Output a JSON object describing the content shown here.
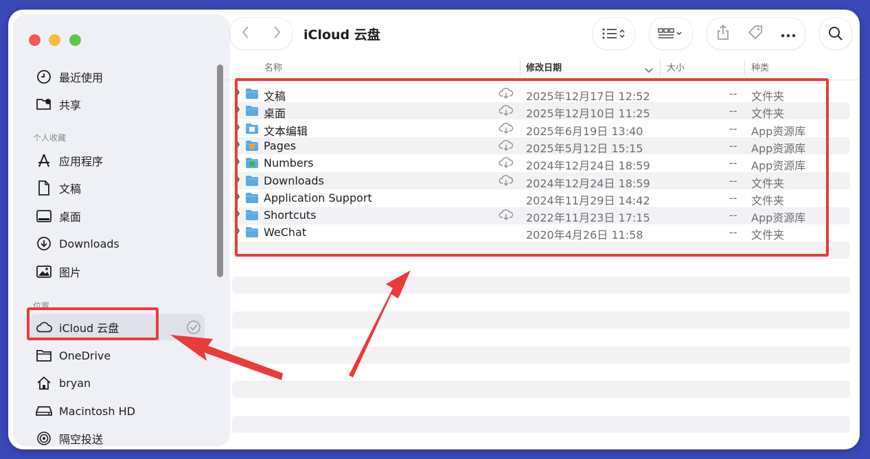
{
  "window": {
    "title": "iCloud 云盘"
  },
  "sidebar": {
    "top_items": [
      {
        "label": "最近使用",
        "icon": "clock-icon"
      },
      {
        "label": "共享",
        "icon": "shared-folder-icon"
      }
    ],
    "favorites_title": "个人收藏",
    "favorites": [
      {
        "label": "应用程序",
        "icon": "apps-icon"
      },
      {
        "label": "文稿",
        "icon": "document-icon"
      },
      {
        "label": "桌面",
        "icon": "desktop-icon"
      },
      {
        "label": "Downloads",
        "icon": "download-icon"
      },
      {
        "label": "图片",
        "icon": "photo-icon"
      }
    ],
    "locations_title": "位置",
    "locations": [
      {
        "label": "iCloud 云盘",
        "icon": "cloud-icon",
        "selected": true
      },
      {
        "label": "OneDrive",
        "icon": "folder-icon"
      },
      {
        "label": "bryan",
        "icon": "home-icon"
      },
      {
        "label": "Macintosh HD",
        "icon": "disk-icon"
      },
      {
        "label": "隔空投送",
        "icon": "airdrop-icon"
      }
    ]
  },
  "columns": {
    "name": "名称",
    "modified": "修改日期",
    "size": "大小",
    "kind": "种类"
  },
  "files": [
    {
      "name": "文稿",
      "cloud": true,
      "date": "2025年12月17日 12:52",
      "size": "--",
      "kind": "文件夹",
      "icon": "folder"
    },
    {
      "name": "桌面",
      "cloud": true,
      "date": "2025年12月10日 11:25",
      "size": "--",
      "kind": "文件夹",
      "icon": "folder"
    },
    {
      "name": "文本编辑",
      "cloud": true,
      "date": "2025年6月19日 13:40",
      "size": "--",
      "kind": "App资源库",
      "icon": "textedit"
    },
    {
      "name": "Pages",
      "cloud": true,
      "date": "2025年5月12日 15:15",
      "size": "--",
      "kind": "App资源库",
      "icon": "pages"
    },
    {
      "name": "Numbers",
      "cloud": true,
      "date": "2024年12月24日 18:59",
      "size": "--",
      "kind": "App资源库",
      "icon": "numbers"
    },
    {
      "name": "Downloads",
      "cloud": true,
      "date": "2024年12月24日 18:59",
      "size": "--",
      "kind": "文件夹",
      "icon": "folder"
    },
    {
      "name": "Application Support",
      "cloud": false,
      "date": "2024年11月29日 14:42",
      "size": "--",
      "kind": "文件夹",
      "icon": "folder"
    },
    {
      "name": "Shortcuts",
      "cloud": true,
      "date": "2022年11月23日 17:15",
      "size": "--",
      "kind": "App资源库",
      "icon": "folder"
    },
    {
      "name": "WeChat",
      "cloud": false,
      "date": "2020年4月26日 11:58",
      "size": "--",
      "kind": "文件夹",
      "icon": "folder"
    }
  ],
  "colors": {
    "accent_folder": "#5aa9e8",
    "annotation": "#ea3b3b",
    "selection": "#dfe2ea"
  }
}
